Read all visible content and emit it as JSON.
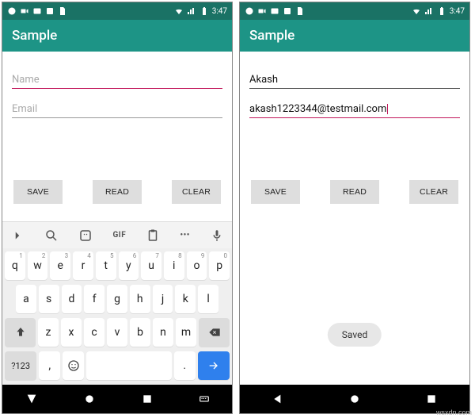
{
  "statusbar": {
    "time": "3:47"
  },
  "appbar": {
    "title": "Sample"
  },
  "left": {
    "name_field": {
      "placeholder": "Name",
      "value": ""
    },
    "email_field": {
      "placeholder": "Email",
      "value": ""
    },
    "buttons": {
      "save": "SAVE",
      "read": "READ",
      "clear": "CLEAR"
    },
    "keyboard": {
      "suggest": {
        "gif": "GIF",
        "dots": "•••"
      },
      "row1": [
        "q",
        "w",
        "e",
        "r",
        "t",
        "y",
        "u",
        "i",
        "o",
        "p"
      ],
      "row1_sup": [
        "1",
        "2",
        "3",
        "4",
        "5",
        "6",
        "7",
        "8",
        "9",
        "0"
      ],
      "row2": [
        "a",
        "s",
        "d",
        "f",
        "g",
        "h",
        "j",
        "k",
        "l"
      ],
      "row3": [
        "z",
        "x",
        "c",
        "v",
        "b",
        "n",
        "m"
      ],
      "fn": {
        "shift": "⇧",
        "sym": "?123",
        "comma": ",",
        "period": ".",
        "backspace": "⌫"
      }
    }
  },
  "right": {
    "name_field": {
      "value": "Akash"
    },
    "email_field": {
      "value": "akash1223344@testmail.com"
    },
    "buttons": {
      "save": "SAVE",
      "read": "READ",
      "clear": "CLEAR"
    },
    "toast": "Saved"
  },
  "watermark": "wsxdn.com"
}
